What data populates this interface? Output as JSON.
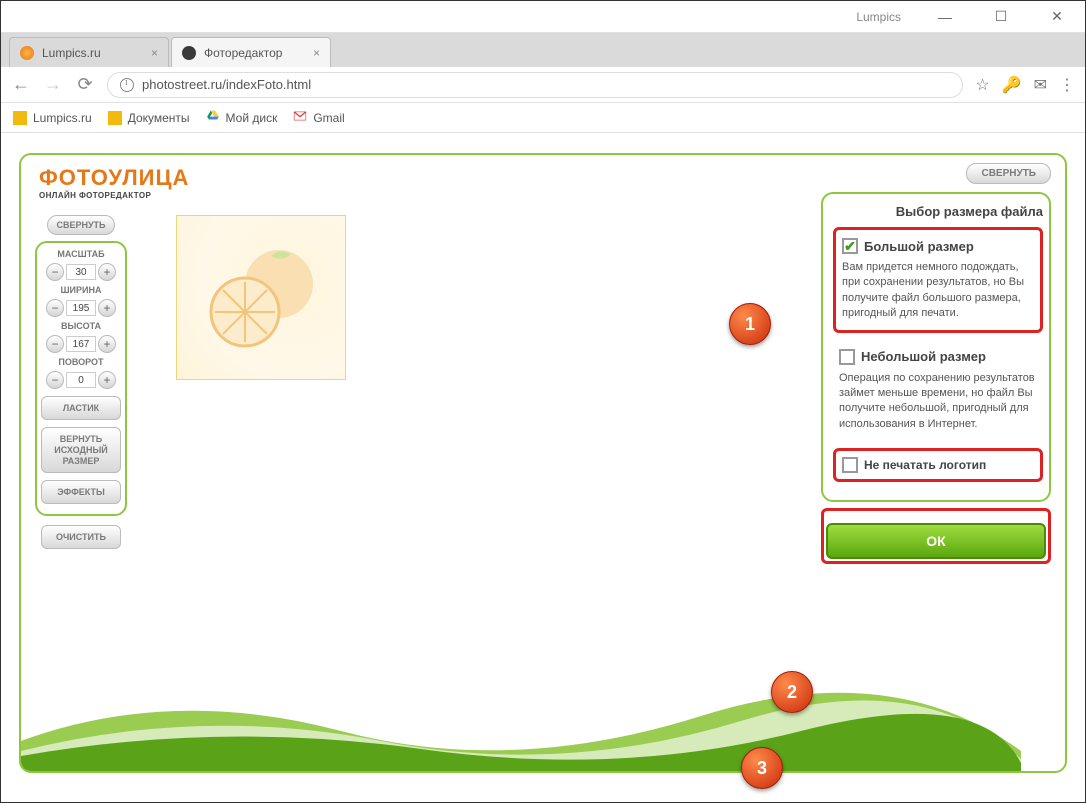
{
  "window": {
    "title": "Lumpics",
    "min": "—",
    "max": "☐",
    "close": "✕"
  },
  "tabs": [
    {
      "label": "Lumpics.ru",
      "icon_color": "#f28c1a"
    },
    {
      "label": "Фоторедактор",
      "icon_color": "#3a3a3a"
    }
  ],
  "address": {
    "url": "photostreet.ru/indexFoto.html"
  },
  "addr_icons": {
    "star": "☆",
    "key": "🔑",
    "mail": "✉",
    "menu": "⋮"
  },
  "bookmarks": [
    {
      "label": "Lumpics.ru",
      "color": "#f2b90f"
    },
    {
      "label": "Документы",
      "color": "#f2b90f"
    },
    {
      "label": "Мой диск",
      "drive": true
    },
    {
      "label": "Gmail",
      "gmail": true
    }
  ],
  "logo": {
    "main": "ФОТОУЛИЦА",
    "sub": "ОНЛАЙН  ФОТОРЕДАКТОР"
  },
  "left": {
    "collapse": "СВЕРНУТЬ",
    "controls": [
      {
        "label": "МАСШТАБ",
        "value": "30"
      },
      {
        "label": "ШИРИНА",
        "value": "195"
      },
      {
        "label": "ВЫСОТА",
        "value": "167"
      },
      {
        "label": "ПОВОРОТ",
        "value": "0"
      }
    ],
    "buttons": {
      "eraser": "ЛАСТИК",
      "reset": "ВЕРНУТЬ ИСХОДНЫЙ РАЗМЕР",
      "effects": "ЭФФЕКТЫ",
      "clear": "ОЧИСТИТЬ"
    }
  },
  "right": {
    "collapse": "СВЕРНУТЬ",
    "title": "Выбор размера файла",
    "big": {
      "title": "Большой размер",
      "desc": "Вам придется немного подождать, при сохранении результатов, но Вы получите файл большого размера, пригодный для печати."
    },
    "small": {
      "title": "Небольшой размер",
      "desc": "Операция по сохранению результатов займет меньше времени, но файл Вы получите небольшой, пригодный для использования в Интернет."
    },
    "nologo": "Не печатать логотип",
    "ok": "ОК"
  },
  "badges": {
    "b1": "1",
    "b2": "2",
    "b3": "3"
  },
  "stepper": {
    "minus": "−",
    "plus": "+"
  },
  "nav": {
    "back": "←",
    "fwd": "→",
    "reload": "⟳",
    "tabx": "×"
  }
}
